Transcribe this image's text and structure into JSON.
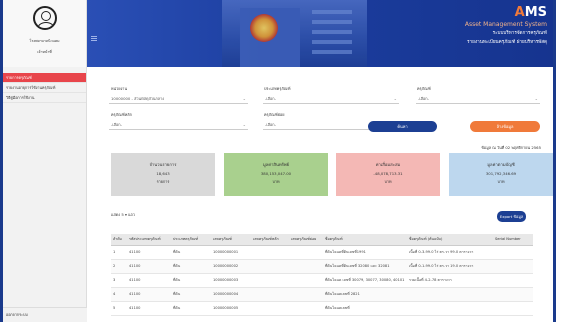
{
  "user": {
    "name": "โรงพยาบาลนิวแฮม",
    "role": "เจ้าหน้าที่"
  },
  "menu": [
    {
      "label": "รายการครุภัณฑ์",
      "active": true
    },
    {
      "label": "รายงานอายุการใช้งานครุภัณฑ์",
      "active": false
    },
    {
      "label": "วิธีคู่มือการใช้งาน",
      "active": false
    }
  ],
  "logout": "ออกจากระบบ",
  "brand": {
    "ams_orange": "A",
    "ams_white": "MS",
    "system": "Asset Management System",
    "th_line1": "ระบบบริหารจัดการครุภัณฑ์",
    "th_line2": "รายงานทะเบียนครุภัณฑ์ ฝ่ายบริหารพัสดุ"
  },
  "filters": {
    "agency_label": "หน่วยงาน",
    "agency_value": "10000000 - ส่วนพัสดุส่วนกลาง",
    "category_label": "ประเภทครุภัณฑ์",
    "category_value": "-เลือก-",
    "asset_label": "ครุภัณฑ์",
    "asset_value": "-เลือก-",
    "group_label": "ครุภัณฑ์หลัก",
    "group_value": "-เลือก-",
    "subgroup_label": "ครุภัณฑ์ย่อย",
    "subgroup_value": "-เลือก-",
    "search_button": "ค้นหา",
    "clear_button": "ล้างข้อมูล"
  },
  "as_of": "ข้อมูล ณ วันที่ 02 พฤศจิกายน 2565",
  "cards": [
    {
      "title": "จำนวนรายการ",
      "value": "18,643",
      "unit": "รายการ"
    },
    {
      "title": "มูลค่าสินทรัพย์",
      "value": "380,153,047.00",
      "unit": "บาท"
    },
    {
      "title": "ค่าเสื่อมสะสม",
      "value": "-48,078,713.31",
      "unit": "บาท"
    },
    {
      "title": "มูลค่าตามบัญชี",
      "value": "301,792,346.69",
      "unit": "บาท"
    }
  ],
  "table_length": {
    "prefix": "แสดง",
    "value": "5",
    "suffix": "แถว"
  },
  "export_button": "Export ข้อมูล",
  "table": {
    "headers": [
      "ลำดับ",
      "รหัสประเภทครุภัณฑ์",
      "ประเภทครุภัณฑ์",
      "เลขครุภัณฑ์",
      "เลขครุภัณฑ์หลัก",
      "เลขครุภัณฑ์ย่อย",
      "ชื่อครุภัณฑ์",
      "ชื่อครุภัณฑ์ (ต้นฉบับ)",
      "Serial Number"
    ],
    "rows": [
      [
        "1",
        "41100",
        "ที่ดิน",
        "10000000001",
        "",
        "",
        "ที่ดินโฉนดที่ดินเลขที่1991",
        "เนื้อที่ 0-3-99.0 ไร่ ตร.วา 99.0 ตารางวา",
        ""
      ],
      [
        "2",
        "41100",
        "ที่ดิน",
        "10000000002",
        "",
        "",
        "ที่ดินโฉนดที่ดินเลขที่ 32080 และ 32081",
        "เนื้อที่ 0-1-99.0 ไร่ ตร.วา 19.0 ตารางวา",
        ""
      ],
      [
        "3",
        "41100",
        "ที่ดิน",
        "10000000003",
        "",
        "",
        "ที่ดินโฉนด เลขที่ 30079, 30077, 30080, 40101",
        "รวมเนื้อที่ 4-2-78 ตารางวา",
        ""
      ],
      [
        "4",
        "41100",
        "ที่ดิน",
        "10000000004",
        "",
        "",
        "ที่ดินโฉนดเลขที่ 2821",
        "",
        ""
      ],
      [
        "5",
        "41100",
        "ที่ดิน",
        "10000000005",
        "",
        "",
        "ที่ดินโฉนดเลขที่",
        "",
        ""
      ]
    ]
  }
}
